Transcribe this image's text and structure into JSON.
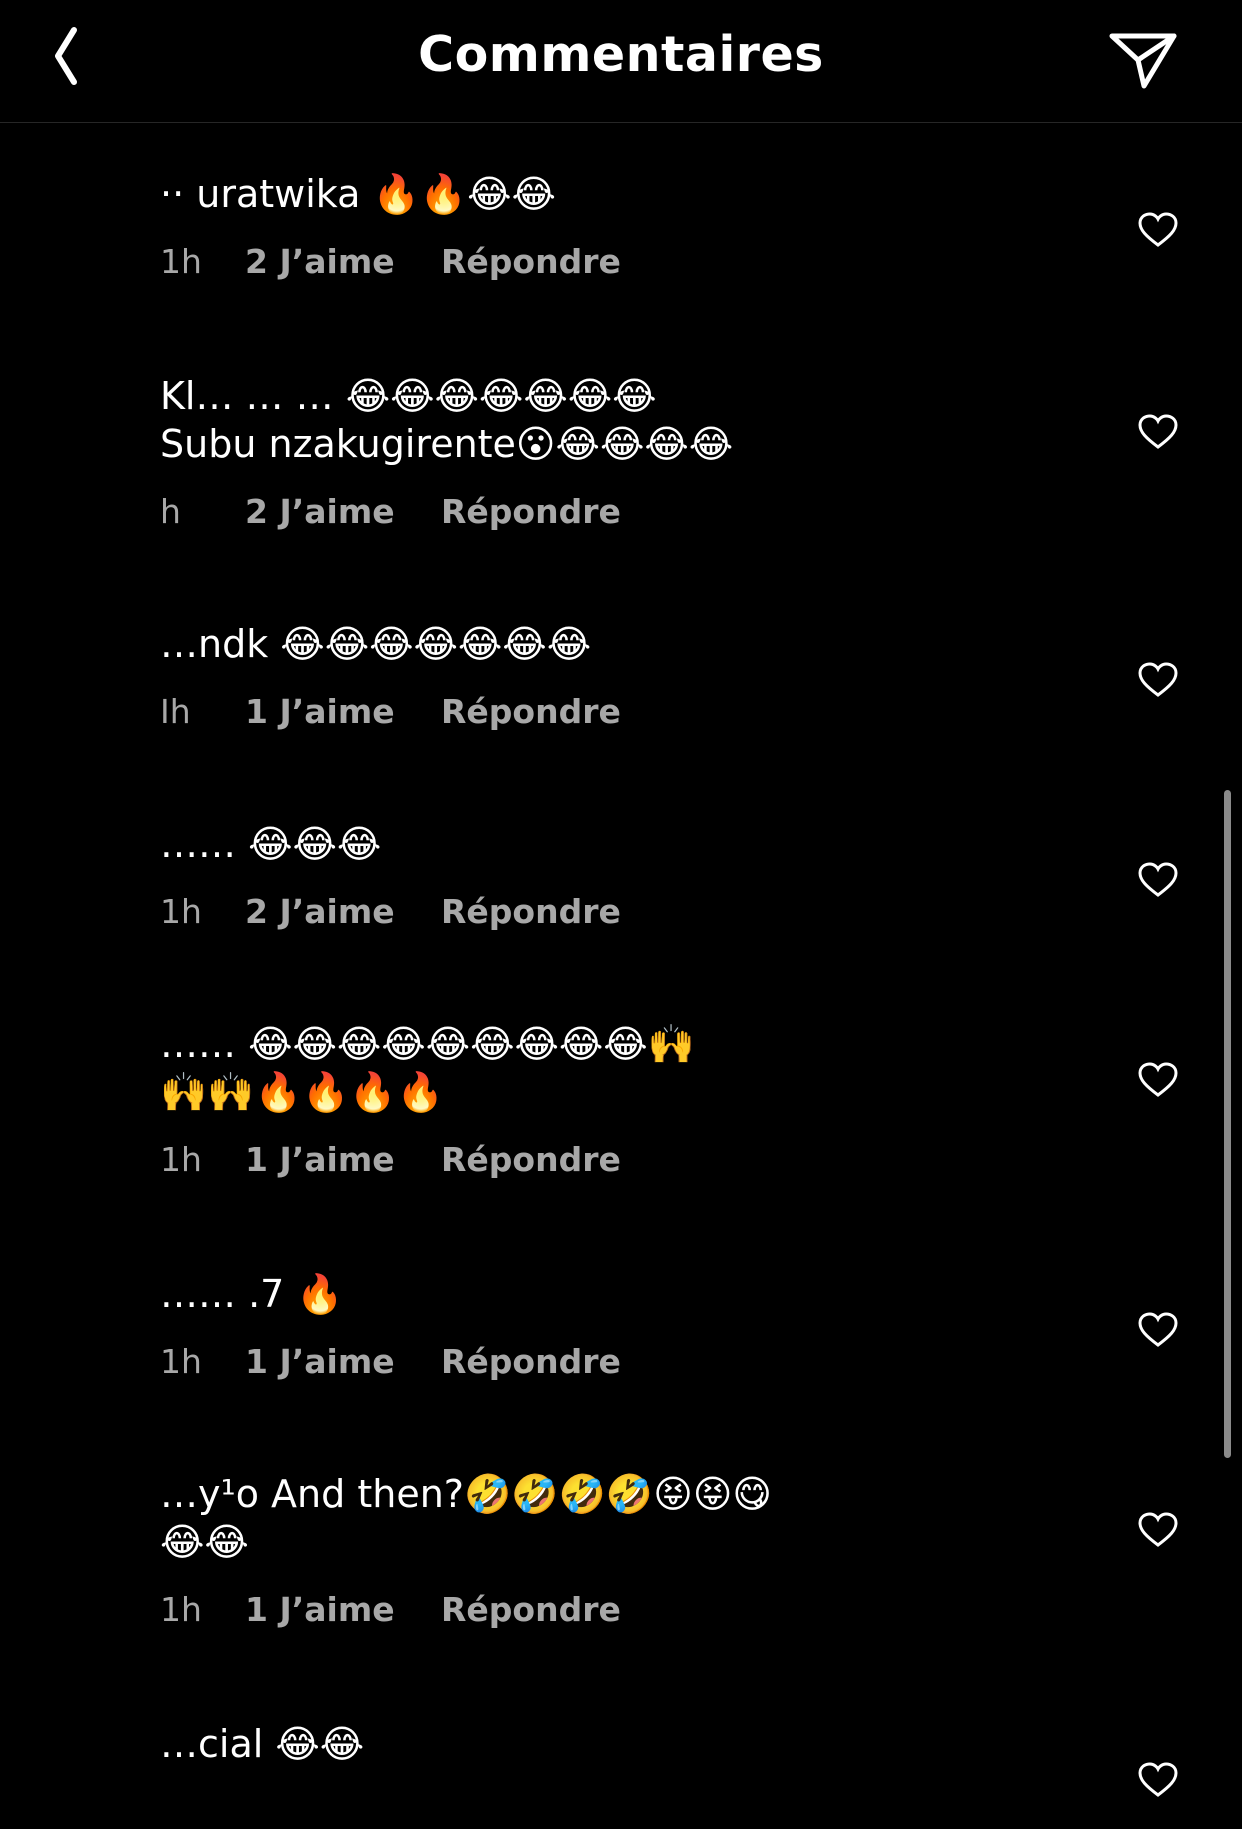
{
  "header": {
    "title": "Commentaires",
    "back_icon": "chevron-left-icon",
    "share_icon": "paper-plane-icon"
  },
  "colors": {
    "background": "#000000",
    "text": "#ffffff",
    "meta_text": "#a8a8a8",
    "divider": "#262626"
  },
  "comments": [
    {
      "text": "·· uratwika 🔥🔥😂😂",
      "time": "1h",
      "likes": "2 J’aime",
      "reply": "Répondre"
    },
    {
      "text": "Kl… … … 😂😂😂😂😂😂😂\nSubu nzakugirente😮😂😂😂😂",
      "time": "h",
      "likes": "2 J’aime",
      "reply": "Répondre"
    },
    {
      "text": "…ndk 😂😂😂😂😂😂😂",
      "time": "Ih",
      "likes": "1 J’aime",
      "reply": "Répondre"
    },
    {
      "text": "…… 😂😂😂",
      "time": "1h",
      "likes": "2 J’aime",
      "reply": "Répondre"
    },
    {
      "text": "…… 😂😂😂😂😂😂😂😂😂🙌\n🙌🙌🔥🔥🔥🔥",
      "time": "1h",
      "likes": "1 J’aime",
      "reply": "Répondre"
    },
    {
      "text": "…… .7 🔥",
      "time": "1h",
      "likes": "1 J’aime",
      "reply": "Répondre"
    },
    {
      "text": "…y¹o And then?🤣🤣🤣🤣😝😝😋\n😂😂",
      "time": "1h",
      "likes": "1 J’aime",
      "reply": "Répondre"
    },
    {
      "text": "…cial 😂😂",
      "time": "",
      "likes": "",
      "reply": ""
    }
  ]
}
